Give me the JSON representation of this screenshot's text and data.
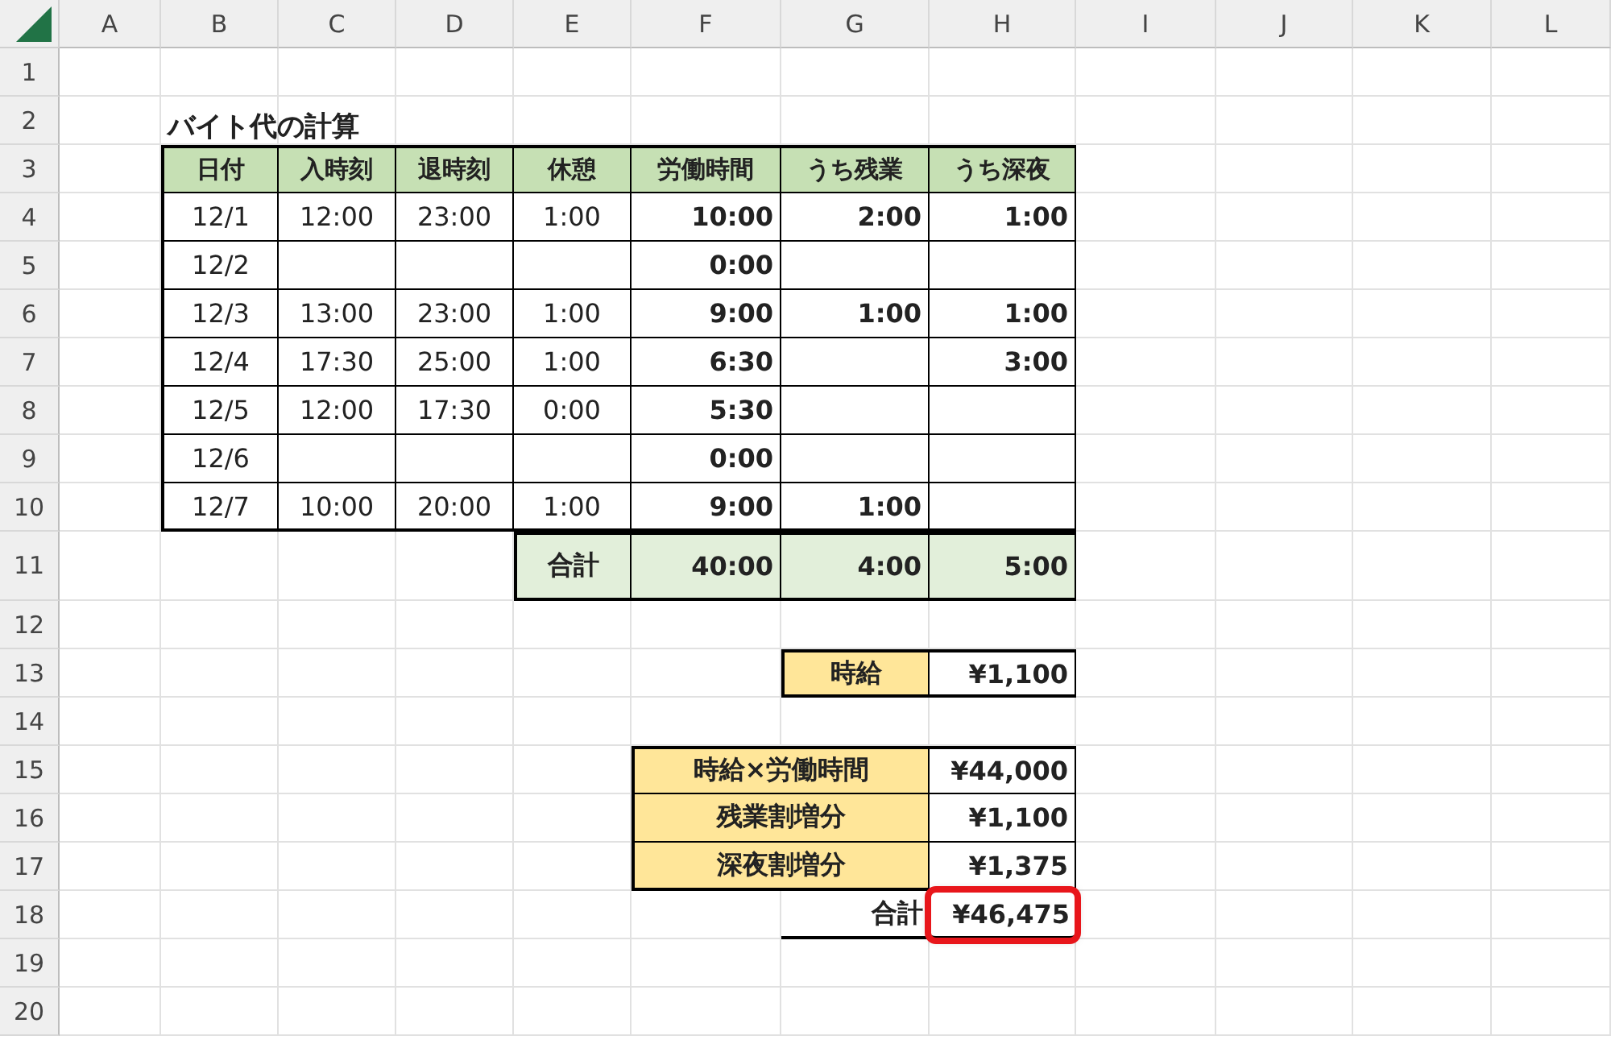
{
  "column_headers": [
    "A",
    "B",
    "C",
    "D",
    "E",
    "F",
    "G",
    "H",
    "I",
    "J",
    "K",
    "L"
  ],
  "row_headers": [
    "1",
    "2",
    "3",
    "4",
    "5",
    "6",
    "7",
    "8",
    "9",
    "10",
    "11",
    "12",
    "13",
    "14",
    "15",
    "16",
    "17",
    "18",
    "19",
    "20"
  ],
  "sheet_title": "バイト代の計算",
  "table": {
    "columns": [
      "日付",
      "入時刻",
      "退時刻",
      "休憩",
      "労働時間",
      "うち残業",
      "うち深夜"
    ],
    "rows": [
      {
        "date": "12/1",
        "start": "12:00",
        "end": "23:00",
        "break": "1:00",
        "work": "10:00",
        "overtime": "2:00",
        "night": "1:00"
      },
      {
        "date": "12/2",
        "work": "0:00"
      },
      {
        "date": "12/3",
        "start": "13:00",
        "end": "23:00",
        "break": "1:00",
        "work": "9:00",
        "overtime": "1:00",
        "night": "1:00"
      },
      {
        "date": "12/4",
        "start": "17:30",
        "end": "25:00",
        "break": "1:00",
        "work": "6:30",
        "night": "3:00"
      },
      {
        "date": "12/5",
        "start": "12:00",
        "end": "17:30",
        "break": "0:00",
        "work": "5:30"
      },
      {
        "date": "12/6",
        "work": "0:00"
      },
      {
        "date": "12/7",
        "start": "10:00",
        "end": "20:00",
        "break": "1:00",
        "work": "9:00",
        "overtime": "1:00"
      }
    ],
    "total": {
      "label": "合計",
      "work": "40:00",
      "overtime": "4:00",
      "night": "5:00"
    }
  },
  "hourly_wage": {
    "label": "時給",
    "value": "¥1,100"
  },
  "pay": {
    "items": [
      {
        "label": "時給×労働時間",
        "value": "¥44,000"
      },
      {
        "label": "残業割増分",
        "value": "¥1,100"
      },
      {
        "label": "深夜割増分",
        "value": "¥1,375"
      }
    ],
    "total": {
      "label": "合計",
      "value": "¥46,475",
      "highlighted": true
    }
  }
}
